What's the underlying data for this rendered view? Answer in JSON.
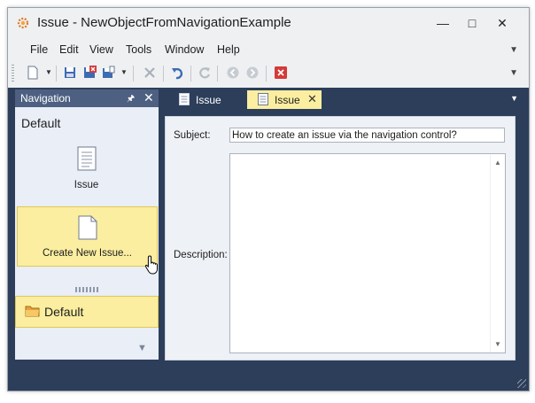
{
  "window": {
    "title": "Issue - NewObjectFromNavigationExample",
    "minimize_icon": "minimize-icon",
    "maximize_icon": "maximize-icon",
    "close_icon": "close-icon"
  },
  "menu": {
    "items": [
      "File",
      "Edit",
      "View",
      "Tools",
      "Window",
      "Help"
    ],
    "overflow_icon": "chevron-down-icon"
  },
  "toolbar": {
    "buttons": [
      "new-object-icon",
      "save-icon",
      "save-and-close-icon",
      "save-and-new-icon",
      "delete-icon",
      "undo-icon",
      "refresh-icon",
      "previous-icon",
      "next-icon",
      "close-view-icon"
    ]
  },
  "navigation": {
    "header": "Navigation",
    "group_title": "Default",
    "items": [
      {
        "label": "Issue",
        "icon": "document-icon"
      },
      {
        "label": "Create New Issue...",
        "icon": "new-document-icon",
        "selected": true
      }
    ],
    "group_bar": "Default"
  },
  "tabs": [
    {
      "label": "Issue",
      "active": false
    },
    {
      "label": "Issue",
      "active": true
    }
  ],
  "form": {
    "subject_label": "Subject:",
    "subject_value": "How to create an issue via the navigation control?",
    "description_label": "Description:",
    "description_value": ""
  },
  "colors": {
    "dock_background": "#2c3e5a",
    "selection": "#fbeea0",
    "nav_header": "#4d6082"
  }
}
